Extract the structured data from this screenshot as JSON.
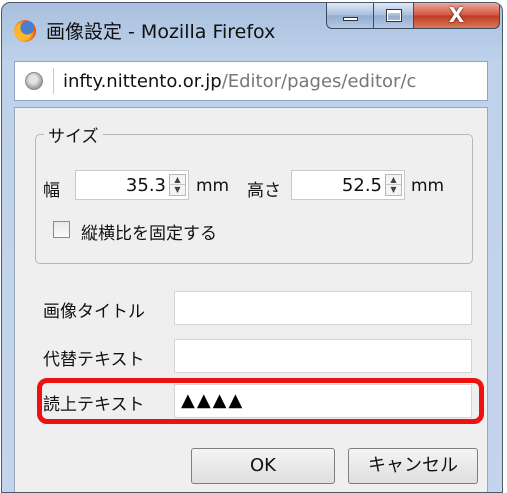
{
  "window": {
    "title": "画像設定 - Mozilla Firefox",
    "close_glyph": "X"
  },
  "urlbar": {
    "host": "infty.nittento.or.jp",
    "path": "/Editor/pages/editor/c"
  },
  "size_group": {
    "legend": "サイズ",
    "width_label": "幅",
    "width_value": "35.3",
    "width_unit": "mm",
    "height_label": "高さ",
    "height_value": "52.5",
    "height_unit": "mm",
    "lock_ratio_label": "縦横比を固定する"
  },
  "fields": {
    "image_title_label": "画像タイトル",
    "image_title_value": "",
    "alt_text_label": "代替テキスト",
    "alt_text_value": "",
    "read_text_label": "読上テキスト",
    "read_text_value": "▲▲▲▲"
  },
  "buttons": {
    "ok": "OK",
    "cancel": "キャンセル"
  },
  "colors": {
    "highlight": "#ee1111"
  }
}
